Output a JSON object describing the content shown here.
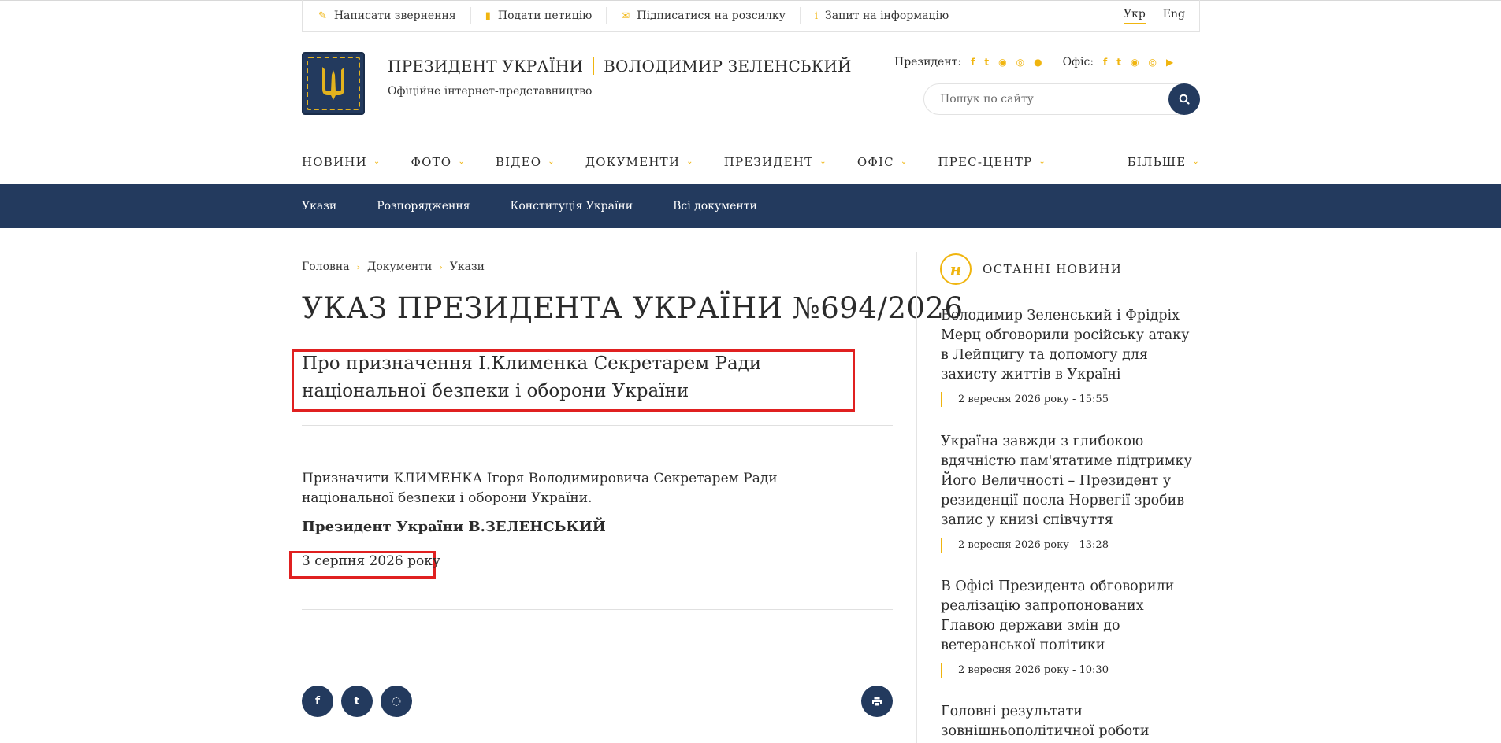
{
  "utility": {
    "items": [
      {
        "label": "Написати звернення",
        "icon": "pencil-icon"
      },
      {
        "label": "Подати петицію",
        "icon": "document-icon"
      },
      {
        "label": "Підписатися на розсилку",
        "icon": "envelope-icon"
      },
      {
        "label": "Запит на інформацію",
        "icon": "info-icon"
      }
    ],
    "languages": [
      "Укр",
      "Eng"
    ],
    "active_language": "Укр"
  },
  "header": {
    "brand_left": "ПРЕЗИДЕНТ УКРАЇНИ",
    "brand_right": "ВОЛОДИМИР ЗЕЛЕНСЬКИЙ",
    "subtitle": "Офіційне інтернет-представництво",
    "president_label": "Президент:",
    "office_label": "Офіс:",
    "search_placeholder": "Пошук по сайту",
    "accent_color": "#f0b50f",
    "brand_color": "#233a5e"
  },
  "nav": {
    "items": [
      "НОВИНИ",
      "ФОТО",
      "ВІДЕО",
      "ДОКУМЕНТИ",
      "ПРЕЗИДЕНТ",
      "ОФІС",
      "ПРЕС-ЦЕНТР"
    ],
    "more": "БІЛЬШЕ"
  },
  "subnav": {
    "items": [
      "Укази",
      "Розпорядження",
      "Конституція України",
      "Всі документи"
    ]
  },
  "breadcrumb": [
    "Головна",
    "Документи",
    "Укази"
  ],
  "article": {
    "title": "УКАЗ ПРЕЗИДЕНТА УКРАЇНИ №694/2026",
    "subtitle": "Про призначення І.Клименка Секретарем Ради національної безпеки і оборони України",
    "body": "Призначити КЛИМЕНКА Ігоря Володимировича Секретарем Ради національної безпеки і оборони України.",
    "signature": "Президент України В.ЗЕЛЕНСЬКИЙ",
    "date": "3 серпня 2026 року"
  },
  "sidebar": {
    "title": "ОСТАННІ НОВИНИ",
    "news": [
      {
        "title": "Володимир Зеленський і Фрідріх Мерц обговорили російську атаку в Лейпцигу та допомогу для захисту життів в Україні",
        "date": "2 вересня 2026 року - 15:55"
      },
      {
        "title": "Україна завжди з глибокою вдячністю пам'ятатиме підтримку Його Величності – Президент у резиденції посла Норвегії зробив запис у книзі співчуття",
        "date": "2 вересня 2026 року - 13:28"
      },
      {
        "title": "В Офісі Президента обговорили реалізацію запропонованих Главою держави змін до ветеранської політики",
        "date": "2 вересня 2026 року - 10:30"
      },
      {
        "title": "Головні результати зовнішньополітичної роботи",
        "date": ""
      }
    ]
  }
}
